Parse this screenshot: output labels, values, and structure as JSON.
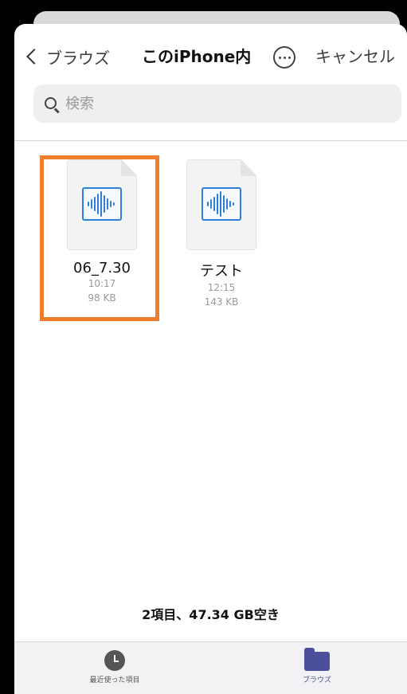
{
  "nav": {
    "back_label": "ブラウズ",
    "title": "このiPhone内",
    "cancel_label": "キャンセル"
  },
  "search": {
    "placeholder": "検索"
  },
  "files": [
    {
      "name": "06_7.30",
      "time": "10:17",
      "size": "98 KB",
      "highlighted": true
    },
    {
      "name": "テスト",
      "time": "12:15",
      "size": "143 KB",
      "highlighted": false
    }
  ],
  "footer": {
    "info": "2項目、47.34 GB空き"
  },
  "tabs": [
    {
      "label": "最近使った項目",
      "icon": "clock-icon",
      "active": false
    },
    {
      "label": "ブラウズ",
      "icon": "folder-icon",
      "active": true
    }
  ],
  "colors": {
    "highlight": "#ee7e2b",
    "audio_icon": "#2f7fd9",
    "active_tab": "#4b4f9b",
    "inactive_tab": "#555555"
  }
}
